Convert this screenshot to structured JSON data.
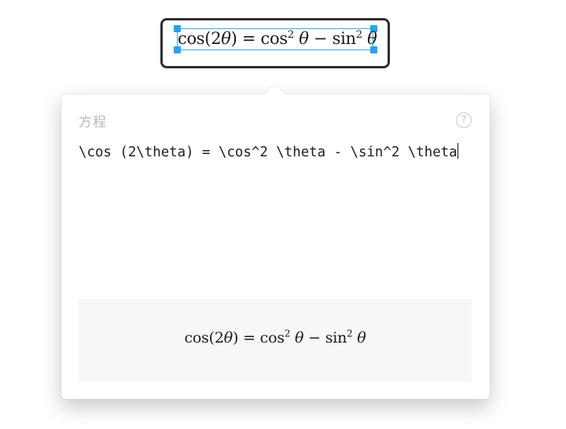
{
  "canvas": {
    "inline_equation": {
      "func1": "cos",
      "paren_open": "(",
      "two": "2",
      "theta": "θ",
      "paren_close": ")",
      "equals": " = ",
      "func2": "cos",
      "sup2": "2",
      "minus": " − ",
      "func3": "sin"
    }
  },
  "popover": {
    "title": "方程",
    "help_symbol": "?",
    "latex_value": "\\cos (2\\theta) = \\cos^2 \\theta - \\sin^2 \\theta"
  },
  "colors": {
    "selection": "#39a8f2",
    "handle": "#24a4f3",
    "frame": "#2f2f2f",
    "preview_bg": "#f7f7f7",
    "title": "#b8b8b8"
  }
}
